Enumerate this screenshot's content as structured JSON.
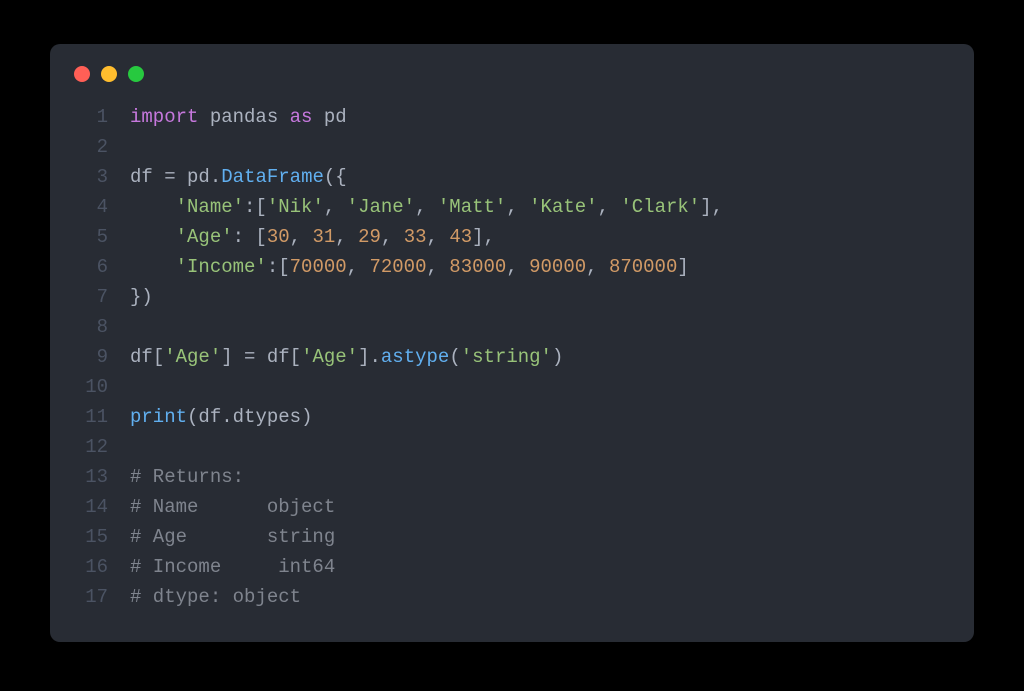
{
  "line_numbers": [
    "1",
    "2",
    "3",
    "4",
    "5",
    "6",
    "7",
    "8",
    "9",
    "10",
    "11",
    "12",
    "13",
    "14",
    "15",
    "16",
    "17"
  ],
  "tokens": {
    "l1": {
      "import": "import",
      "pandas": "pandas",
      "as": "as",
      "pd": "pd"
    },
    "l3": {
      "df": "df",
      "eq": " = ",
      "pd": "pd",
      "dot": ".",
      "DataFrame": "DataFrame",
      "open": "({"
    },
    "l4": {
      "indent": "    ",
      "key": "'Name'",
      "colon": ":[",
      "v1": "'Nik'",
      "c1": ", ",
      "v2": "'Jane'",
      "c2": ", ",
      "v3": "'Matt'",
      "c3": ", ",
      "v4": "'Kate'",
      "c4": ", ",
      "v5": "'Clark'",
      "close": "],"
    },
    "l5": {
      "indent": "    ",
      "key": "'Age'",
      "colon": ": [",
      "v1": "30",
      "c1": ", ",
      "v2": "31",
      "c2": ", ",
      "v3": "29",
      "c3": ", ",
      "v4": "33",
      "c4": ", ",
      "v5": "43",
      "close": "],"
    },
    "l6": {
      "indent": "    ",
      "key": "'Income'",
      "colon": ":[",
      "v1": "70000",
      "c1": ", ",
      "v2": "72000",
      "c2": ", ",
      "v3": "83000",
      "c3": ", ",
      "v4": "90000",
      "c4": ", ",
      "v5": "870000",
      "close": "]"
    },
    "l7": {
      "close": "})"
    },
    "l9": {
      "df1": "df",
      "b1": "[",
      "k1": "'Age'",
      "b2": "] ",
      "eq": "=",
      "sp": " ",
      "df2": "df",
      "b3": "[",
      "k2": "'Age'",
      "b4": "].",
      "fn": "astype",
      "p1": "(",
      "arg": "'string'",
      "p2": ")"
    },
    "l11": {
      "print": "print",
      "p1": "(",
      "df": "df",
      "dot": ".",
      "prop": "dtypes",
      "p2": ")"
    },
    "l13": "# Returns:",
    "l14": "# Name      object",
    "l15": "# Age       string",
    "l16": "# Income     int64",
    "l17": "# dtype: object"
  }
}
